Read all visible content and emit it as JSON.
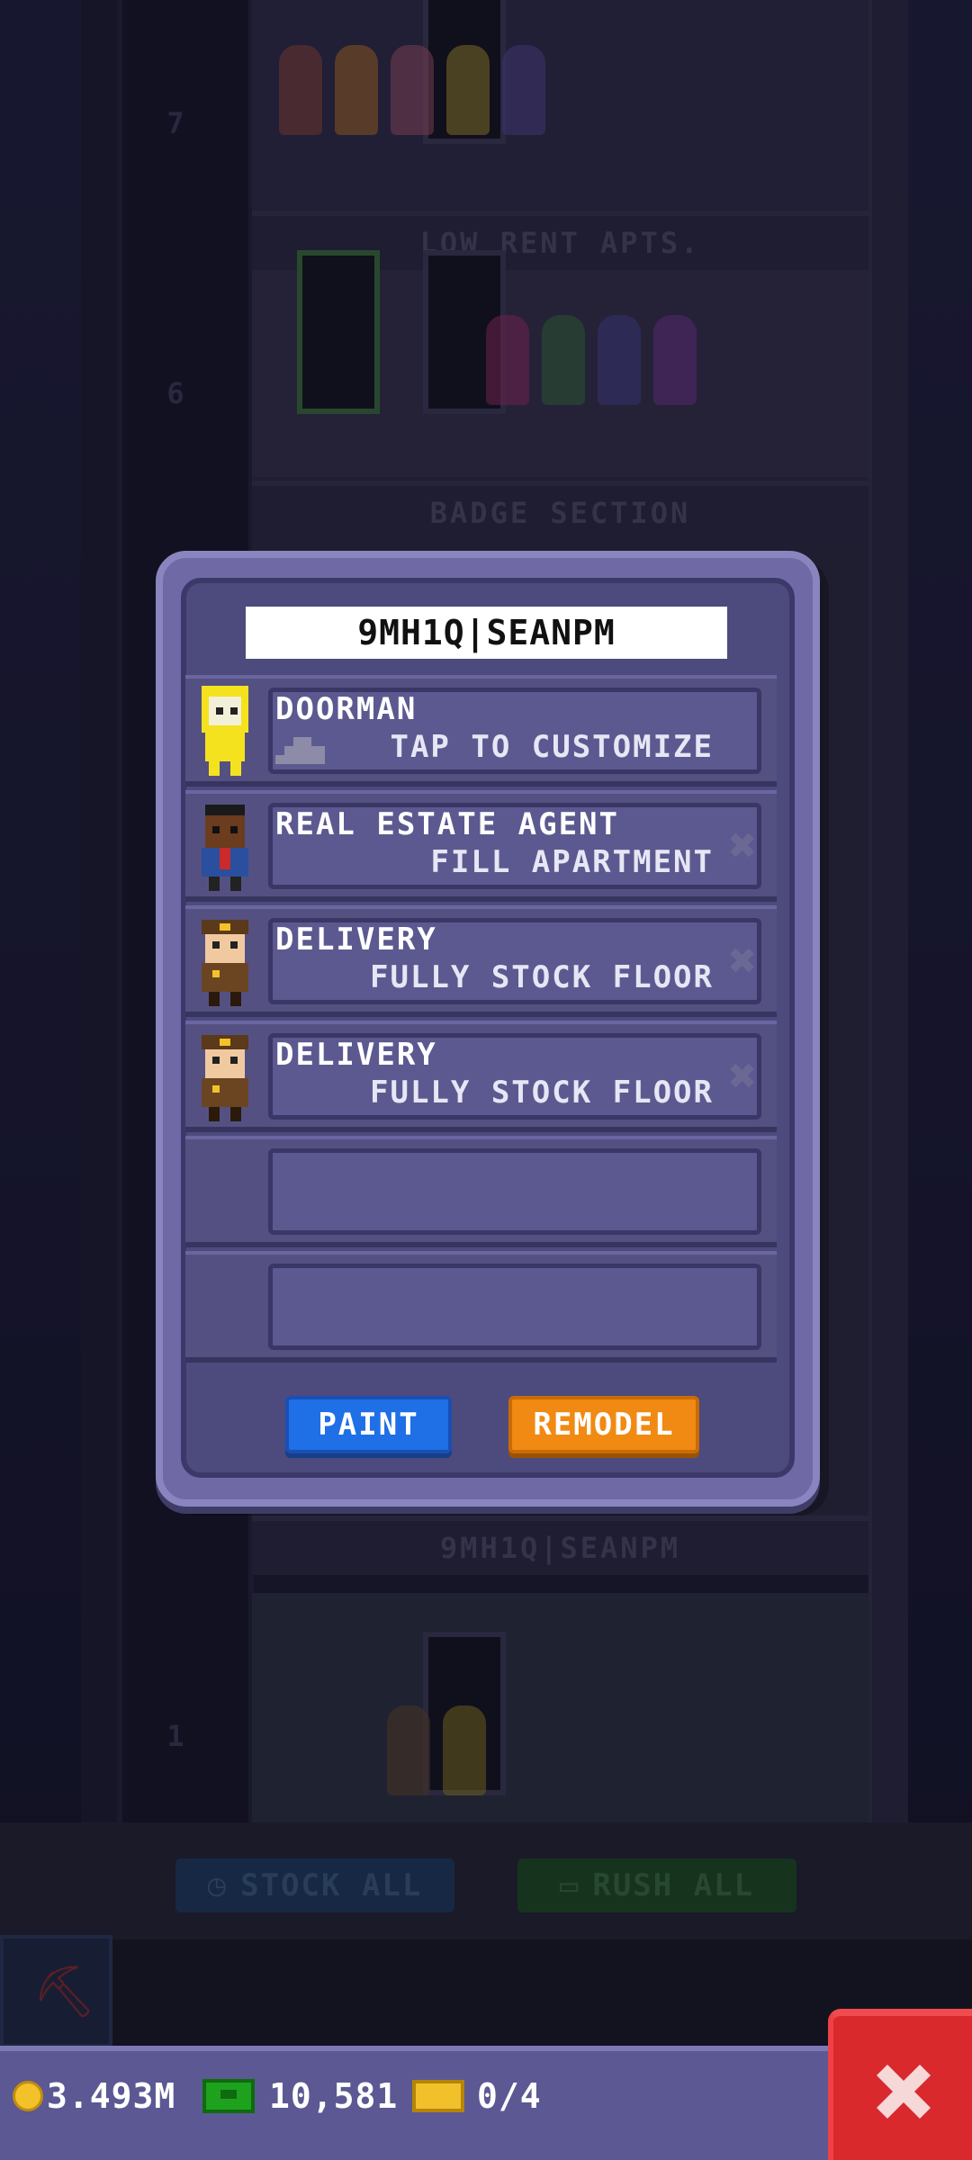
{
  "tower": {
    "floors": [
      {
        "number": "7",
        "label": "LOW RENT APTS."
      },
      {
        "number": "6",
        "label": "BADGE SECTION"
      },
      {
        "number": "",
        "label": "9MH1Q|SEANPM"
      },
      {
        "number": "1",
        "label": ""
      }
    ]
  },
  "toolbar": {
    "stock_all": "STOCK ALL",
    "rush_all": "RUSH ALL"
  },
  "dialog": {
    "floor_name": "9MH1Q|SEANPM",
    "slots": [
      {
        "title": "DOORMAN",
        "subtitle": "TAP TO CUSTOMIZE",
        "avatar": "doorman-avatar",
        "removable": false
      },
      {
        "title": "REAL ESTATE AGENT",
        "subtitle": "FILL APARTMENT",
        "avatar": "agent-avatar",
        "removable": true
      },
      {
        "title": "DELIVERY",
        "subtitle": "FULLY STOCK FLOOR",
        "avatar": "delivery-avatar",
        "removable": true
      },
      {
        "title": "DELIVERY",
        "subtitle": "FULLY STOCK FLOOR",
        "avatar": "delivery-avatar",
        "removable": true
      },
      {
        "title": "",
        "subtitle": "",
        "avatar": "",
        "removable": false
      },
      {
        "title": "",
        "subtitle": "",
        "avatar": "",
        "removable": false
      }
    ],
    "remove_symbol": "✖",
    "paint_label": "PAINT",
    "remodel_label": "REMODEL"
  },
  "status": {
    "coins": "3.493M",
    "bux": "10,581",
    "tickets": "0/4"
  },
  "colors": {
    "paint_button": "#1f6fe6",
    "remodel_button": "#f18a12",
    "close_button": "#d9292d",
    "dialog_frame": "#6f6aa6"
  }
}
